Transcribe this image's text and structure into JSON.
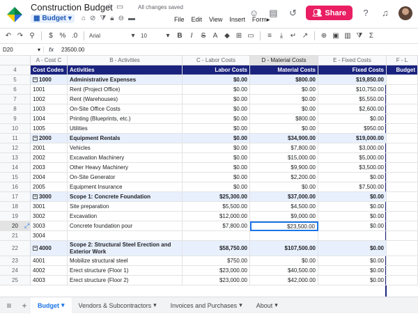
{
  "app": {
    "doc_title": "Construction Budget",
    "saved_status": "All changes saved",
    "sheet_chip": "Budget",
    "menus": [
      "File",
      "Edit",
      "View",
      "Insert",
      "Form▸"
    ],
    "share_label": "Share",
    "colors": {
      "accent": "#1a73e8",
      "share": "#e91e63",
      "header_bg": "#1a237e",
      "group_bg": "#e8f0fe"
    }
  },
  "toolbar": {
    "font": "Arial",
    "size": "10"
  },
  "formula_bar": {
    "cell_ref": "D20",
    "value": "23500.00"
  },
  "columns": [
    {
      "label": "A - Cost C",
      "selected": false
    },
    {
      "label": "B - Activities",
      "selected": false
    },
    {
      "label": "C - Labor Costs",
      "selected": false
    },
    {
      "label": "D - Material Costs",
      "selected": true
    },
    {
      "label": "E - Fixed Costs",
      "selected": false
    },
    {
      "label": "F - L",
      "selected": false
    }
  ],
  "rows": [
    {
      "n": "4",
      "type": "head",
      "cells": [
        "Cost Codes",
        "Activities",
        "Labor Costs",
        "Material Costs",
        "Fixed Costs",
        "Budget"
      ]
    },
    {
      "n": "5",
      "type": "group",
      "cells": [
        "1000",
        "Administrative Expenses",
        "$0.00",
        "$800.00",
        "$19,850.00",
        ""
      ]
    },
    {
      "n": "6",
      "type": "item",
      "cells": [
        "1001",
        "Rent (Project Office)",
        "$0.00",
        "$0.00",
        "$10,750.00",
        ""
      ]
    },
    {
      "n": "7",
      "type": "item",
      "cells": [
        "1002",
        "Rent (Warehouses)",
        "$0.00",
        "$0.00",
        "$5,550.00",
        ""
      ]
    },
    {
      "n": "8",
      "type": "item",
      "cells": [
        "1003",
        "On-Site Office Costs",
        "$0.00",
        "$0.00",
        "$2,600.00",
        ""
      ]
    },
    {
      "n": "9",
      "type": "item",
      "cells": [
        "1004",
        "Printing (Blueprints, etc.)",
        "$0.00",
        "$800.00",
        "$0.00",
        ""
      ]
    },
    {
      "n": "10",
      "type": "item",
      "cells": [
        "1005",
        "Utilities",
        "$0.00",
        "$0.00",
        "$950.00",
        ""
      ]
    },
    {
      "n": "11",
      "type": "group",
      "cells": [
        "2000",
        "Equipment Rentals",
        "$0.00",
        "$34,900.00",
        "$19,000.00",
        ""
      ]
    },
    {
      "n": "12",
      "type": "item",
      "cells": [
        "2001",
        "Vehicles",
        "$0.00",
        "$7,800.00",
        "$3,000.00",
        ""
      ]
    },
    {
      "n": "13",
      "type": "item",
      "cells": [
        "2002",
        "Excavation Machinery",
        "$0.00",
        "$15,000.00",
        "$5,000.00",
        ""
      ]
    },
    {
      "n": "14",
      "type": "item",
      "cells": [
        "2003",
        "Other Heavy Machinery",
        "$0.00",
        "$9,900.00",
        "$3,500.00",
        ""
      ]
    },
    {
      "n": "15",
      "type": "item",
      "cells": [
        "2004",
        "On-Site Generator",
        "$0.00",
        "$2,200.00",
        "$0.00",
        ""
      ]
    },
    {
      "n": "16",
      "type": "item",
      "cells": [
        "2005",
        "Equipment Insurance",
        "$0.00",
        "$0.00",
        "$7,500.00",
        ""
      ]
    },
    {
      "n": "17",
      "type": "group",
      "cells": [
        "3000",
        "Scope 1: Concrete Foundation",
        "$25,300.00",
        "$37,000.00",
        "$0.00",
        ""
      ]
    },
    {
      "n": "18",
      "type": "item",
      "cells": [
        "3001",
        "Site preparation",
        "$5,500.00",
        "$4,500.00",
        "$0.00",
        ""
      ]
    },
    {
      "n": "19",
      "type": "item",
      "cells": [
        "3002",
        "Excavation",
        "$12,000.00",
        "$9,000.00",
        "$0.00",
        ""
      ]
    },
    {
      "n": "20",
      "type": "item",
      "active": true,
      "cells": [
        "3003",
        "Concrete foundation pour",
        "$7,800.00",
        "$23,500.00",
        "$0.00",
        ""
      ]
    },
    {
      "n": "21",
      "type": "item",
      "cells": [
        "3004",
        "",
        "",
        "",
        "",
        ""
      ]
    },
    {
      "n": "22",
      "type": "group",
      "tall": true,
      "cells": [
        "4000",
        "Scope 2: Structural Steel Erection and Exterior Work",
        "$58,750.00",
        "$107,500.00",
        "$0.00",
        ""
      ]
    },
    {
      "n": "23",
      "type": "item",
      "cells": [
        "4001",
        "Mobilize structural steel",
        "$750.00",
        "$0.00",
        "$0.00",
        ""
      ]
    },
    {
      "n": "24",
      "type": "item",
      "cells": [
        "4002",
        "Erect structure (Floor 1)",
        "$23,000.00",
        "$40,500.00",
        "$0.00",
        ""
      ]
    },
    {
      "n": "25",
      "type": "item",
      "cells": [
        "4003",
        "Erect structure (Floor 2)",
        "$23,000.00",
        "$42,000.00",
        "$0.00",
        ""
      ]
    }
  ],
  "tabs": [
    "Budget",
    "Vendors & Subcontractors",
    "Invoices and Purchases",
    "About"
  ]
}
